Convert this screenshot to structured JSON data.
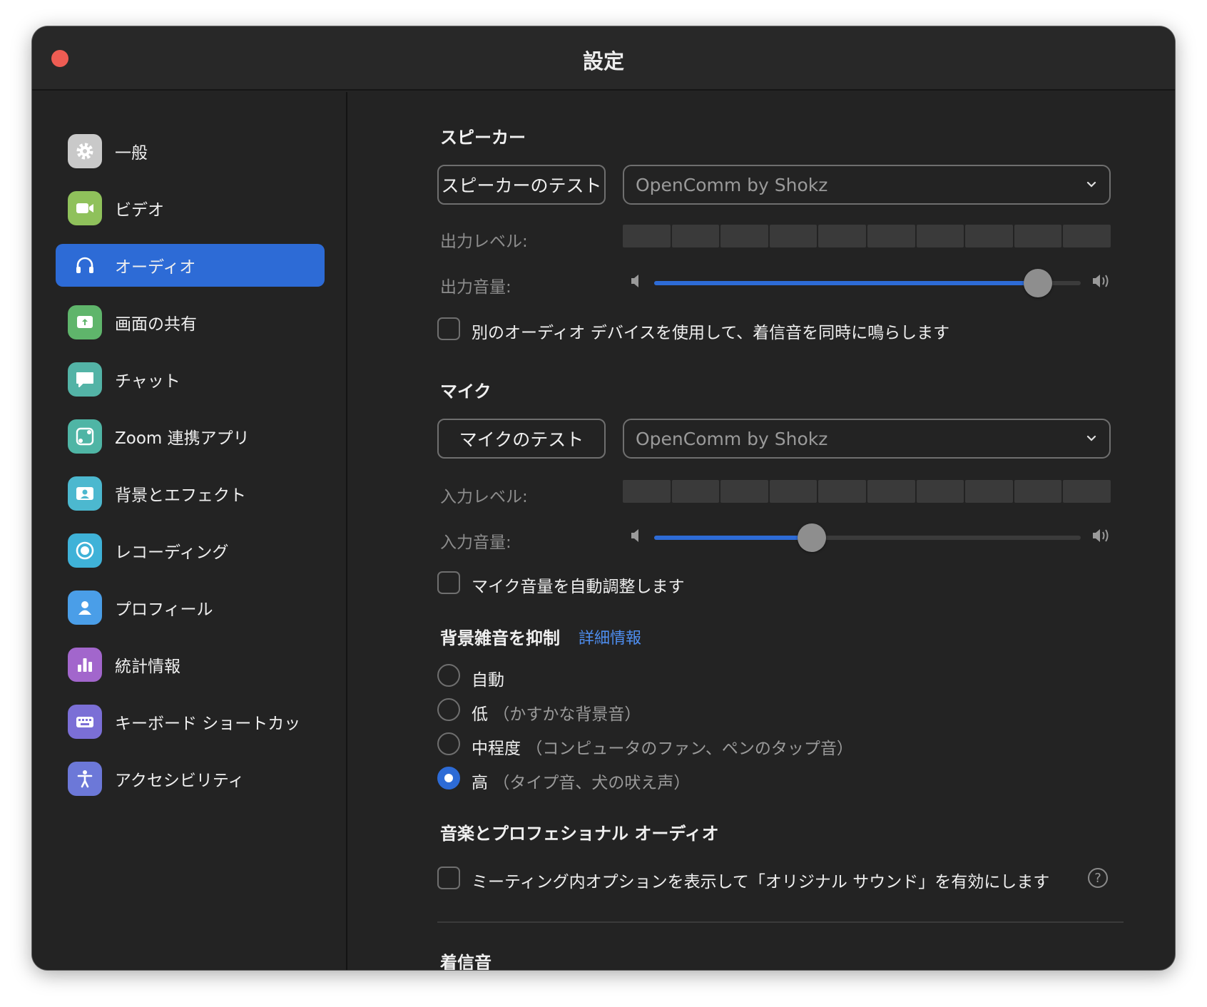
{
  "window": {
    "title": "設定"
  },
  "sidebar": {
    "items": [
      {
        "label": "一般",
        "icon": "gear-icon",
        "color": "#c9c9c9"
      },
      {
        "label": "ビデオ",
        "icon": "video-camera-icon",
        "color": "#8fc15b"
      },
      {
        "label": "オーディオ",
        "icon": "headphones-icon",
        "color": "#2d6bd6",
        "active": true
      },
      {
        "label": "画面の共有",
        "icon": "share-screen-icon",
        "color": "#5fb56b"
      },
      {
        "label": "チャット",
        "icon": "chat-bubble-icon",
        "color": "#53b3a6"
      },
      {
        "label": "Zoom 連携アプリ",
        "icon": "apps-icon",
        "color": "#4fb5a5"
      },
      {
        "label": "背景とエフェクト",
        "icon": "background-person-icon",
        "color": "#4cb8cf"
      },
      {
        "label": "レコーディング",
        "icon": "record-icon",
        "color": "#3fb2d8"
      },
      {
        "label": "プロフィール",
        "icon": "profile-icon",
        "color": "#4a9ee8"
      },
      {
        "label": "統計情報",
        "icon": "bar-chart-icon",
        "color": "#a266cc"
      },
      {
        "label": "キーボード ショートカッ",
        "icon": "keyboard-icon",
        "color": "#7b6fd6"
      },
      {
        "label": "アクセシビリティ",
        "icon": "accessibility-icon",
        "color": "#6c78d8"
      }
    ]
  },
  "speaker": {
    "title": "スピーカー",
    "test_button": "スピーカーのテスト",
    "device": "OpenComm by Shokz",
    "output_level_label": "出力レベル:",
    "output_volume_label": "出力音量:",
    "output_volume": 0.9,
    "ring_checkbox_label": "別のオーディオ デバイスを使用して、着信音を同時に鳴らします"
  },
  "mic": {
    "title": "マイク",
    "test_button": "マイクのテスト",
    "device": "OpenComm by Shokz",
    "input_level_label": "入力レベル:",
    "input_volume_label": "入力音量:",
    "input_volume": 0.37,
    "auto_adjust_label": "マイク音量を自動調整します"
  },
  "noise": {
    "title": "背景雑音を抑制",
    "link": "詳細情報",
    "options": [
      {
        "label": "自動",
        "sub": ""
      },
      {
        "label": "低",
        "sub": "（かすかな背景音）"
      },
      {
        "label": "中程度",
        "sub": "（コンピュータのファン、ペンのタップ音）"
      },
      {
        "label": "高",
        "sub": "（タイプ音、犬の吠え声）",
        "checked": true
      }
    ]
  },
  "music": {
    "title": "音楽とプロフェショナル オーディオ",
    "original_sound_label": "ミーティング内オプションを表示して「オリジナル サウンド」を有効にします",
    "help_glyph": "?"
  },
  "ringtone": {
    "title": "着信音"
  }
}
